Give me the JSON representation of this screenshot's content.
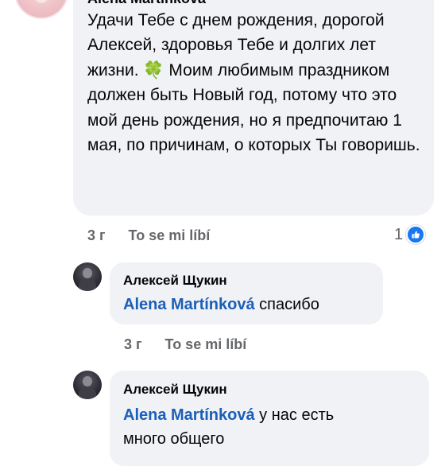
{
  "top_comment": {
    "author": "Alena Martínková",
    "text_before_icon": "Удачи Тебе с днем рождения, дорогой Алексей, здоровья Тебе и долгих лет жизни.",
    "icon": "four-leaf-clover-icon",
    "text_after_icon": "Моим любимым праздником должен быть Новый год, потому что это мой день рождения, но я предпочитаю 1 мая, по причинам, о которых Ты говоришь.",
    "time": "3 г",
    "like_label": "To se mi líbí",
    "reaction_count": "1",
    "reaction_icon": "like-thumb-icon"
  },
  "replies": [
    {
      "author": "Алексей Щукин",
      "mention": "Alena Martínková",
      "text": "спасибо",
      "time": "3 г",
      "like_label": "To se mi líbí"
    },
    {
      "author": "Алексей Щукин",
      "mention": "Alena Martínková",
      "text": "у нас есть",
      "text_line2": "много общего"
    }
  ],
  "colors": {
    "bubble": "#f0f2f5",
    "mention": "#1b5fb8",
    "meta": "#65676b",
    "like_badge": "#1877f2"
  }
}
